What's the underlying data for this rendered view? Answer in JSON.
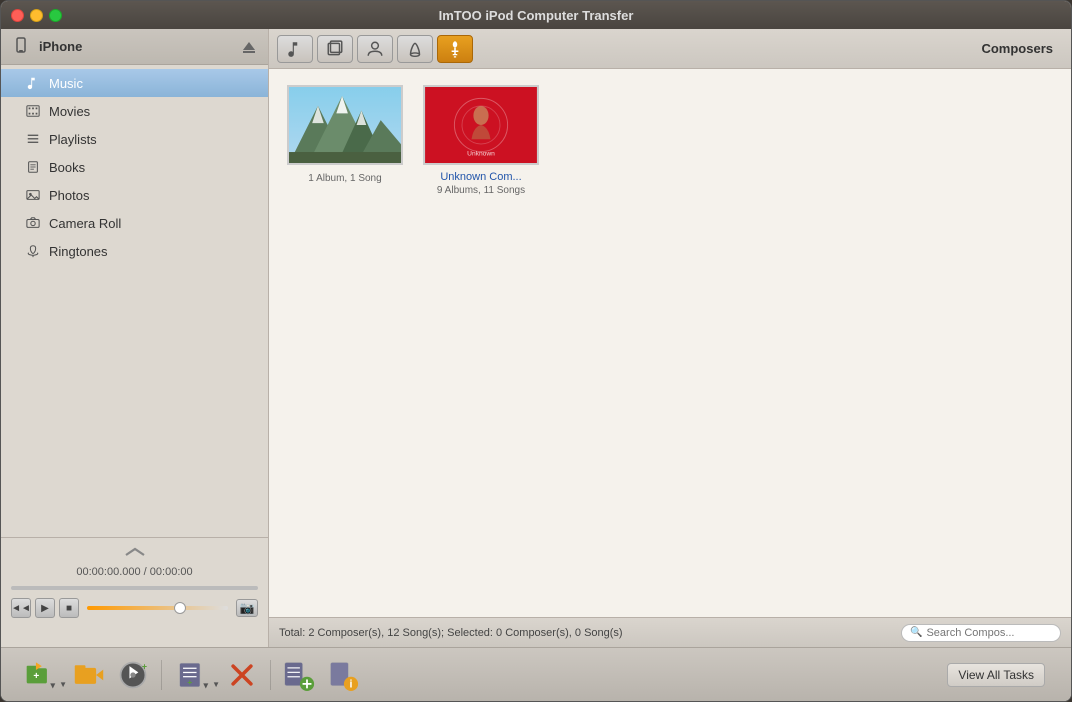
{
  "window": {
    "title": "ImTOO iPod Computer Transfer"
  },
  "titlebar": {
    "title": "ImTOO iPod Computer Transfer",
    "traffic_lights": {
      "close": "close",
      "minimize": "minimize",
      "maximize": "maximize"
    }
  },
  "sidebar": {
    "device_name": "iPhone",
    "items": [
      {
        "id": "music",
        "label": "Music",
        "icon": "♪",
        "active": true
      },
      {
        "id": "movies",
        "label": "Movies",
        "icon": "▦"
      },
      {
        "id": "playlists",
        "label": "Playlists",
        "icon": "≡"
      },
      {
        "id": "books",
        "label": "Books",
        "icon": "📖"
      },
      {
        "id": "photos",
        "label": "Photos",
        "icon": "🖼"
      },
      {
        "id": "camera-roll",
        "label": "Camera Roll",
        "icon": "📷"
      },
      {
        "id": "ringtones",
        "label": "Ringtones",
        "icon": "♫"
      }
    ],
    "time_display": "00:00:00.000 / 00:00:00"
  },
  "content": {
    "toolbar": {
      "tabs": [
        {
          "id": "songs",
          "icon": "♪",
          "active": false
        },
        {
          "id": "albums",
          "icon": "🎵",
          "active": false
        },
        {
          "id": "artists",
          "icon": "👤",
          "active": false
        },
        {
          "id": "genres",
          "icon": "🎸",
          "active": false
        },
        {
          "id": "composers",
          "icon": "🎼",
          "active": true
        }
      ],
      "current_view": "Composers"
    },
    "composers": [
      {
        "id": "composer-1",
        "name": "1 Album, 1 Song",
        "display_name": "",
        "album_count": 1,
        "song_count": 1,
        "thumb_type": "mountain"
      },
      {
        "id": "composer-2",
        "name": "Unknown Com...",
        "display_name": "Unknown Com...",
        "album_count": 9,
        "song_count": 11,
        "thumb_type": "red-album"
      }
    ]
  },
  "status_bar": {
    "text": "Total: 2 Composer(s), 12 Song(s); Selected: 0 Composer(s), 0 Song(s)",
    "search_placeholder": "Search Compos..."
  },
  "bottom_toolbar": {
    "buttons": [
      {
        "id": "add-from-pc",
        "icon": "add-pc",
        "has_dropdown": true
      },
      {
        "id": "transfer-to-pc",
        "icon": "transfer-pc",
        "has_dropdown": false
      },
      {
        "id": "add-music",
        "icon": "add-music",
        "has_dropdown": false
      },
      {
        "id": "separator1",
        "type": "separator"
      },
      {
        "id": "add-playlist",
        "icon": "add-playlist",
        "has_dropdown": true
      },
      {
        "id": "delete",
        "icon": "delete",
        "has_dropdown": false
      },
      {
        "id": "separator2",
        "type": "separator"
      },
      {
        "id": "playlist-export",
        "icon": "playlist-export",
        "has_dropdown": false
      },
      {
        "id": "info",
        "icon": "info",
        "has_dropdown": false
      }
    ],
    "view_all_tasks": "View All Tasks"
  }
}
